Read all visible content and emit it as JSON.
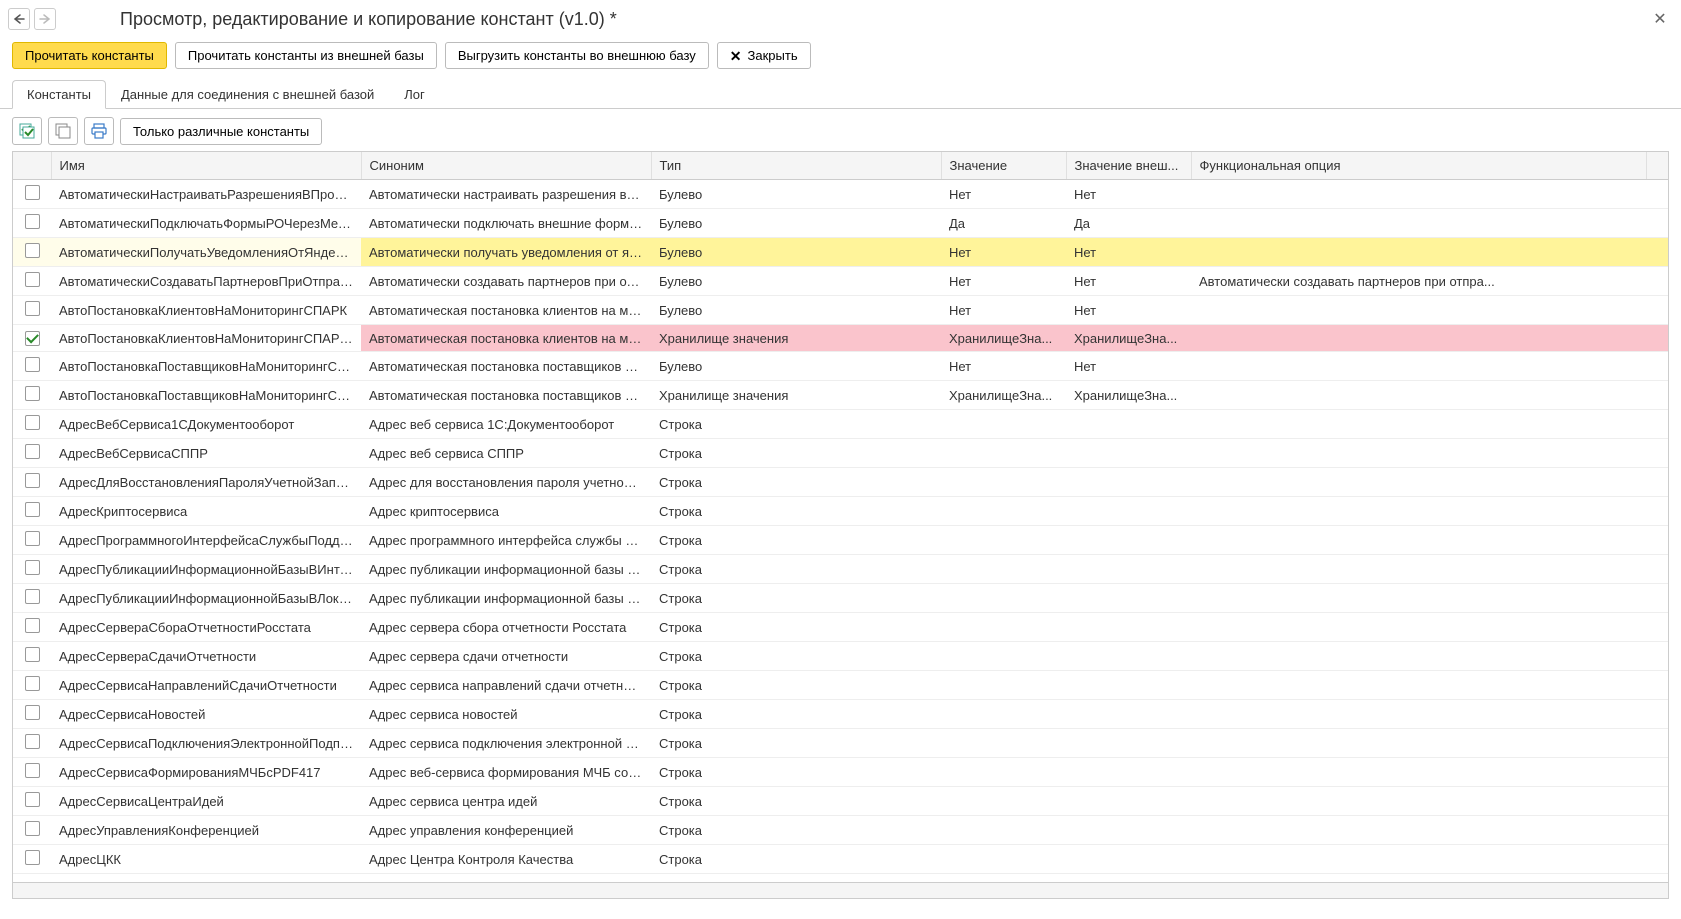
{
  "title": "Просмотр, редактирование и копирование констант (v1.0) *",
  "toolbar": {
    "read": "Прочитать константы",
    "read_ext": "Прочитать константы из внешней базы",
    "export_ext": "Выгрузить константы во внешнюю базу",
    "close": "Закрыть"
  },
  "tabs": {
    "constants": "Константы",
    "connection": "Данные для соединения с внешней базой",
    "log": "Лог"
  },
  "subtoolbar": {
    "only_diff": "Только различные константы"
  },
  "columns": {
    "name": "Имя",
    "synonym": "Синоним",
    "type": "Тип",
    "value": "Значение",
    "value_ext": "Значение внеш...",
    "func_opt": "Функциональная опция"
  },
  "rows": [
    {
      "checked": false,
      "name": "АвтоматическиНастраиватьРазрешенияВПрофил...",
      "synonym": "Автоматически настраивать разрешения в про...",
      "type": "Булево",
      "value": "Нет",
      "value_ext": "Нет",
      "func_opt": "",
      "hl": ""
    },
    {
      "checked": false,
      "name": "АвтоматическиПодключатьФормыРОЧерезМеха...",
      "synonym": "Автоматически подключать внешние формы р...",
      "type": "Булево",
      "value": "Да",
      "value_ext": "Да",
      "func_opt": "",
      "hl": ""
    },
    {
      "checked": false,
      "name": "АвтоматическиПолучатьУведомленияОтЯндексК...",
      "synonym": "Автоматически получать уведомления от янде...",
      "type": "Булево",
      "value": "Нет",
      "value_ext": "Нет",
      "func_opt": "",
      "hl": "yellow"
    },
    {
      "checked": false,
      "name": "АвтоматическиСоздаватьПартнеровПриОтправке...",
      "synonym": "Автоматически создавать партнеров при отпр...",
      "type": "Булево",
      "value": "Нет",
      "value_ext": "Нет",
      "func_opt": "Автоматически создавать партнеров при отпра...",
      "hl": ""
    },
    {
      "checked": false,
      "name": "АвтоПостановкаКлиентовНаМониторингСПАРК",
      "synonym": "Автоматическая постановка клиентов на мони...",
      "type": "Булево",
      "value": "Нет",
      "value_ext": "Нет",
      "func_opt": "",
      "hl": ""
    },
    {
      "checked": true,
      "name": "АвтоПостановкаКлиентовНаМониторингСПАРКН...",
      "synonym": "Автоматическая постановка клиентов на мони...",
      "type": "Хранилище значения",
      "value": "ХранилищеЗна...",
      "value_ext": "ХранилищеЗна...",
      "func_opt": "",
      "hl": "pink"
    },
    {
      "checked": false,
      "name": "АвтоПостановкаПоставщиковНаМониторингСПАРК",
      "synonym": "Автоматическая постановка поставщиков на ...",
      "type": "Булево",
      "value": "Нет",
      "value_ext": "Нет",
      "func_opt": "",
      "hl": ""
    },
    {
      "checked": false,
      "name": "АвтоПостановкаПоставщиковНаМониторингСПА...",
      "synonym": "Автоматическая постановка поставщиков на ...",
      "type": "Хранилище значения",
      "value": "ХранилищеЗна...",
      "value_ext": "ХранилищеЗна...",
      "func_opt": "",
      "hl": ""
    },
    {
      "checked": false,
      "name": "АдресВебСервиса1СДокументооборот",
      "synonym": "Адрес веб сервиса 1С:Документооборот",
      "type": "Строка",
      "value": "",
      "value_ext": "",
      "func_opt": "",
      "hl": ""
    },
    {
      "checked": false,
      "name": "АдресВебСервисаСППР",
      "synonym": "Адрес веб сервиса СППР",
      "type": "Строка",
      "value": "",
      "value_ext": "",
      "func_opt": "",
      "hl": ""
    },
    {
      "checked": false,
      "name": "АдресДляВосстановленияПароляУчетнойЗаписи",
      "synonym": "Адрес для восстановления пароля учетной за...",
      "type": "Строка",
      "value": "",
      "value_ext": "",
      "func_opt": "",
      "hl": ""
    },
    {
      "checked": false,
      "name": "АдресКриптосервиса",
      "synonym": "Адрес криптосервиса",
      "type": "Строка",
      "value": "",
      "value_ext": "",
      "func_opt": "",
      "hl": ""
    },
    {
      "checked": false,
      "name": "АдресПрограммногоИнтерфейсаСлужбыПоддер...",
      "synonym": "Адрес программного интерфейса службы под...",
      "type": "Строка",
      "value": "",
      "value_ext": "",
      "func_opt": "",
      "hl": ""
    },
    {
      "checked": false,
      "name": "АдресПубликацииИнформационнойБазыВИнтерн...",
      "synonym": "Адрес публикации информационной базы в ин...",
      "type": "Строка",
      "value": "",
      "value_ext": "",
      "func_opt": "",
      "hl": ""
    },
    {
      "checked": false,
      "name": "АдресПубликацииИнформационнойБазыВЛокаль...",
      "synonym": "Адрес публикации информационной базы в ло...",
      "type": "Строка",
      "value": "",
      "value_ext": "",
      "func_opt": "",
      "hl": ""
    },
    {
      "checked": false,
      "name": "АдресСервераСбораОтчетностиРосстата",
      "synonym": "Адрес сервера сбора отчетности Росстата",
      "type": "Строка",
      "value": "",
      "value_ext": "",
      "func_opt": "",
      "hl": ""
    },
    {
      "checked": false,
      "name": "АдресСервераСдачиОтчетности",
      "synonym": "Адрес сервера сдачи отчетности",
      "type": "Строка",
      "value": "",
      "value_ext": "",
      "func_opt": "",
      "hl": ""
    },
    {
      "checked": false,
      "name": "АдресСервисаНаправленийСдачиОтчетности",
      "synonym": "Адрес сервиса направлений сдачи отчетности",
      "type": "Строка",
      "value": "",
      "value_ext": "",
      "func_opt": "",
      "hl": ""
    },
    {
      "checked": false,
      "name": "АдресСервисаНовостей",
      "synonym": "Адрес сервиса новостей",
      "type": "Строка",
      "value": "",
      "value_ext": "",
      "func_opt": "",
      "hl": ""
    },
    {
      "checked": false,
      "name": "АдресСервисаПодключенияЭлектроннойПодпис...",
      "synonym": "Адрес сервиса подключения электронной под...",
      "type": "Строка",
      "value": "",
      "value_ext": "",
      "func_opt": "",
      "hl": ""
    },
    {
      "checked": false,
      "name": "АдресСервисаФормированияМЧБсPDF417",
      "synonym": "Адрес веб-сервиса формирования МЧБ со шт...",
      "type": "Строка",
      "value": "",
      "value_ext": "",
      "func_opt": "",
      "hl": ""
    },
    {
      "checked": false,
      "name": "АдресСервисаЦентраИдей",
      "synonym": "Адрес сервиса центра идей",
      "type": "Строка",
      "value": "",
      "value_ext": "",
      "func_opt": "",
      "hl": ""
    },
    {
      "checked": false,
      "name": "АдресУправленияКонференцией",
      "synonym": "Адрес управления конференцией",
      "type": "Строка",
      "value": "",
      "value_ext": "",
      "func_opt": "",
      "hl": ""
    },
    {
      "checked": false,
      "name": "АдресЦКК",
      "synonym": "Адрес Центра Контроля Качества",
      "type": "Строка",
      "value": "",
      "value_ext": "",
      "func_opt": "",
      "hl": ""
    }
  ]
}
